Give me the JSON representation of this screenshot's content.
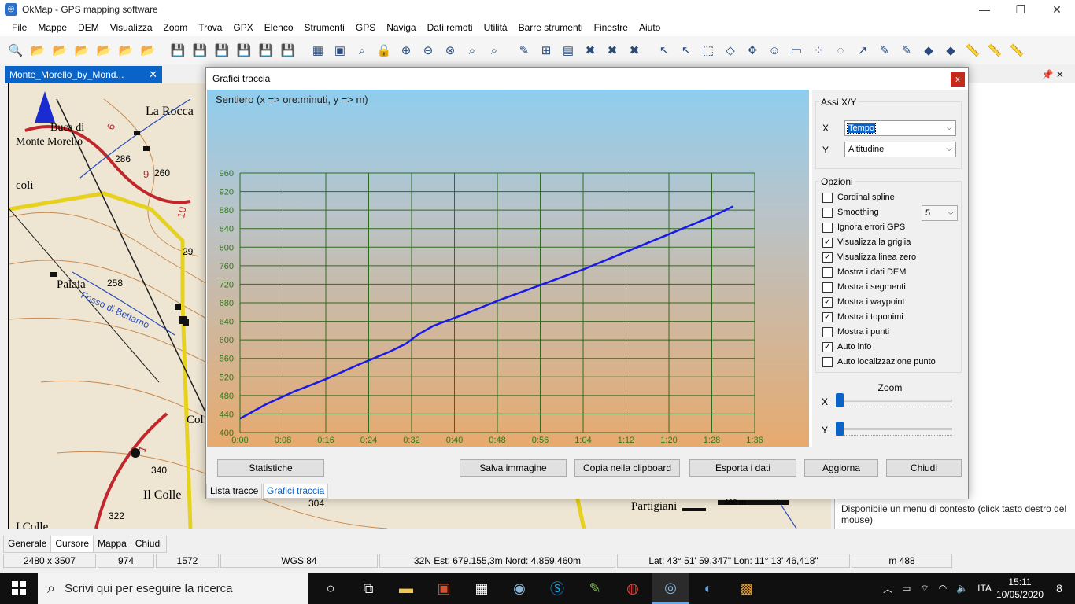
{
  "window": {
    "title": "OkMap - GPS mapping software",
    "minimize": "—",
    "maximize": "❐",
    "close": "✕"
  },
  "menu": [
    "File",
    "Mappe",
    "DEM",
    "Visualizza",
    "Zoom",
    "Trova",
    "GPX",
    "Elenco",
    "Strumenti",
    "GPS",
    "Naviga",
    "Dati remoti",
    "Utilità",
    "Barre strumenti",
    "Finestre",
    "Aiuto"
  ],
  "document_tab": {
    "label": "Monte_Morello_by_Mond...",
    "close": "✕"
  },
  "map": {
    "labels": [
      "La Rocca",
      "Buca di",
      "Monte Morello",
      "286",
      "260",
      "coli",
      "Palaia",
      "258",
      "29",
      "Fosso di Bettarno",
      "Col",
      "340",
      "Il Colle",
      "322",
      "I Colle",
      "304",
      "Partigiani",
      "400 m",
      "9",
      "10",
      "6",
      "1"
    ]
  },
  "right_panel": {
    "info": "Disponibile un menu di contesto (click tasto destro del mouse)"
  },
  "dialog": {
    "title": "Grafici traccia",
    "close": "x",
    "chart_header": "Sentiero (x => ore:minuti, y => m)",
    "axes_group": "Assi X/Y",
    "x_axis_label": "X",
    "y_axis_label": "Y",
    "x_axis_value": "Tempo",
    "y_axis_value": "Altitudine",
    "options_group": "Opzioni",
    "options": [
      {
        "label": "Cardinal spline",
        "checked": false
      },
      {
        "label": "Smoothing",
        "checked": false
      },
      {
        "label": "Ignora errori GPS",
        "checked": false
      },
      {
        "label": "Visualizza la griglia",
        "checked": true
      },
      {
        "label": "Visualizza linea zero",
        "checked": true
      },
      {
        "label": "Mostra i dati DEM",
        "checked": false
      },
      {
        "label": "Mostra i segmenti",
        "checked": false
      },
      {
        "label": "Mostra i waypoint",
        "checked": true
      },
      {
        "label": "Mostra i toponimi",
        "checked": true
      },
      {
        "label": "Mostra i punti",
        "checked": false
      },
      {
        "label": "Auto info",
        "checked": true
      },
      {
        "label": "Auto localizzazione punto",
        "checked": false
      }
    ],
    "smoothing_value": "5",
    "zoom_label": "Zoom",
    "zoom_x_label": "X",
    "zoom_y_label": "Y",
    "zoom_x": 0,
    "zoom_y": 0,
    "buttons": {
      "statistics": "Statistiche",
      "save_image": "Salva immagine",
      "copy_clipboard": "Copia nella clipboard",
      "export": "Esporta i dati",
      "refresh": "Aggiorna",
      "close": "Chiudi"
    },
    "tabs": [
      {
        "label": "Lista tracce",
        "active": false
      },
      {
        "label": "Grafici traccia",
        "active": true
      }
    ]
  },
  "chart_data": {
    "type": "line",
    "title": "Sentiero (x => ore:minuti, y => m)",
    "xlabel": "",
    "ylabel": "",
    "x_ticks": [
      "0:00",
      "0:08",
      "0:16",
      "0:24",
      "0:32",
      "0:40",
      "0:48",
      "0:56",
      "1:04",
      "1:12",
      "1:20",
      "1:28",
      "1:36"
    ],
    "y_ticks": [
      400,
      440,
      480,
      520,
      560,
      600,
      640,
      680,
      720,
      760,
      800,
      840,
      880,
      920,
      960
    ],
    "xlim_minutes": [
      0,
      96
    ],
    "ylim": [
      400,
      960
    ],
    "grid": true,
    "series": [
      {
        "color": "#1a1ae6",
        "x_minutes": [
          0,
          5,
          10,
          16,
          22,
          28,
          31,
          33,
          36,
          42,
          48,
          56,
          64,
          72,
          80,
          88,
          92
        ],
        "y": [
          430,
          462,
          488,
          515,
          546,
          575,
          592,
          610,
          630,
          656,
          684,
          718,
          752,
          790,
          828,
          866,
          888
        ]
      }
    ],
    "grid_color": "#2f6b1f",
    "tick_color": "#2f7a1a"
  },
  "bottom_tabs": [
    "Generale",
    "Cursore",
    "Mappa",
    "Chiudi"
  ],
  "bottom_tab_active": "Cursore",
  "status": [
    "2480 x 3507",
    "974",
    "1572",
    "WGS 84",
    "32N  Est: 679.155,3m  Nord: 4.859.460m",
    "Lat: 43° 51' 59,347\"  Lon: 11° 13' 46,418\"",
    "m 488"
  ],
  "taskbar": {
    "search_placeholder": "Scrivi qui per eseguire la ricerca",
    "lang": "ITA",
    "time": "15:11",
    "date": "10/05/2020",
    "notifications": "8"
  }
}
